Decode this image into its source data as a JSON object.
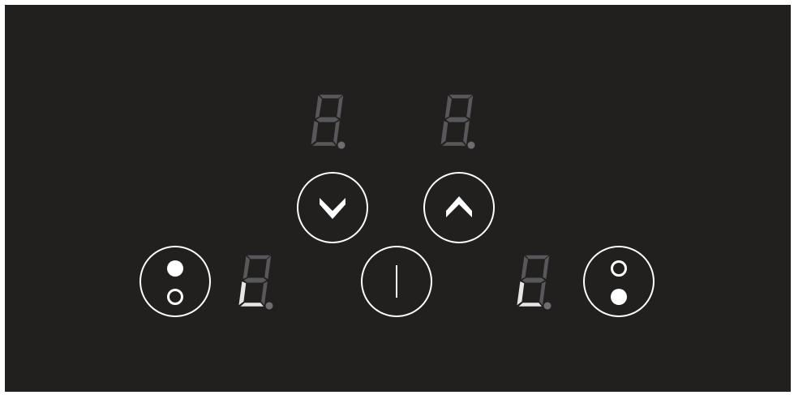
{
  "panel": {
    "background": "#221f1f",
    "accent": "#ffffff",
    "segment_off_color": "#58585a",
    "segment_on_color": "#e6e6e6"
  },
  "displays": {
    "top_left": {
      "lit_segments": []
    },
    "top_right": {
      "lit_segments": []
    },
    "bottom_left": {
      "lit_segments": [
        "e",
        "d"
      ]
    },
    "bottom_right": {
      "lit_segments": [
        "e",
        "d"
      ]
    }
  },
  "buttons": {
    "minus": {
      "icon": "chevron-down-icon"
    },
    "plus": {
      "icon": "chevron-up-icon"
    },
    "power": {
      "icon": "power-bar-icon"
    },
    "zone_left": {
      "icon": "zone-front-dots-icon"
    },
    "zone_right": {
      "icon": "zone-rear-dots-icon"
    }
  }
}
